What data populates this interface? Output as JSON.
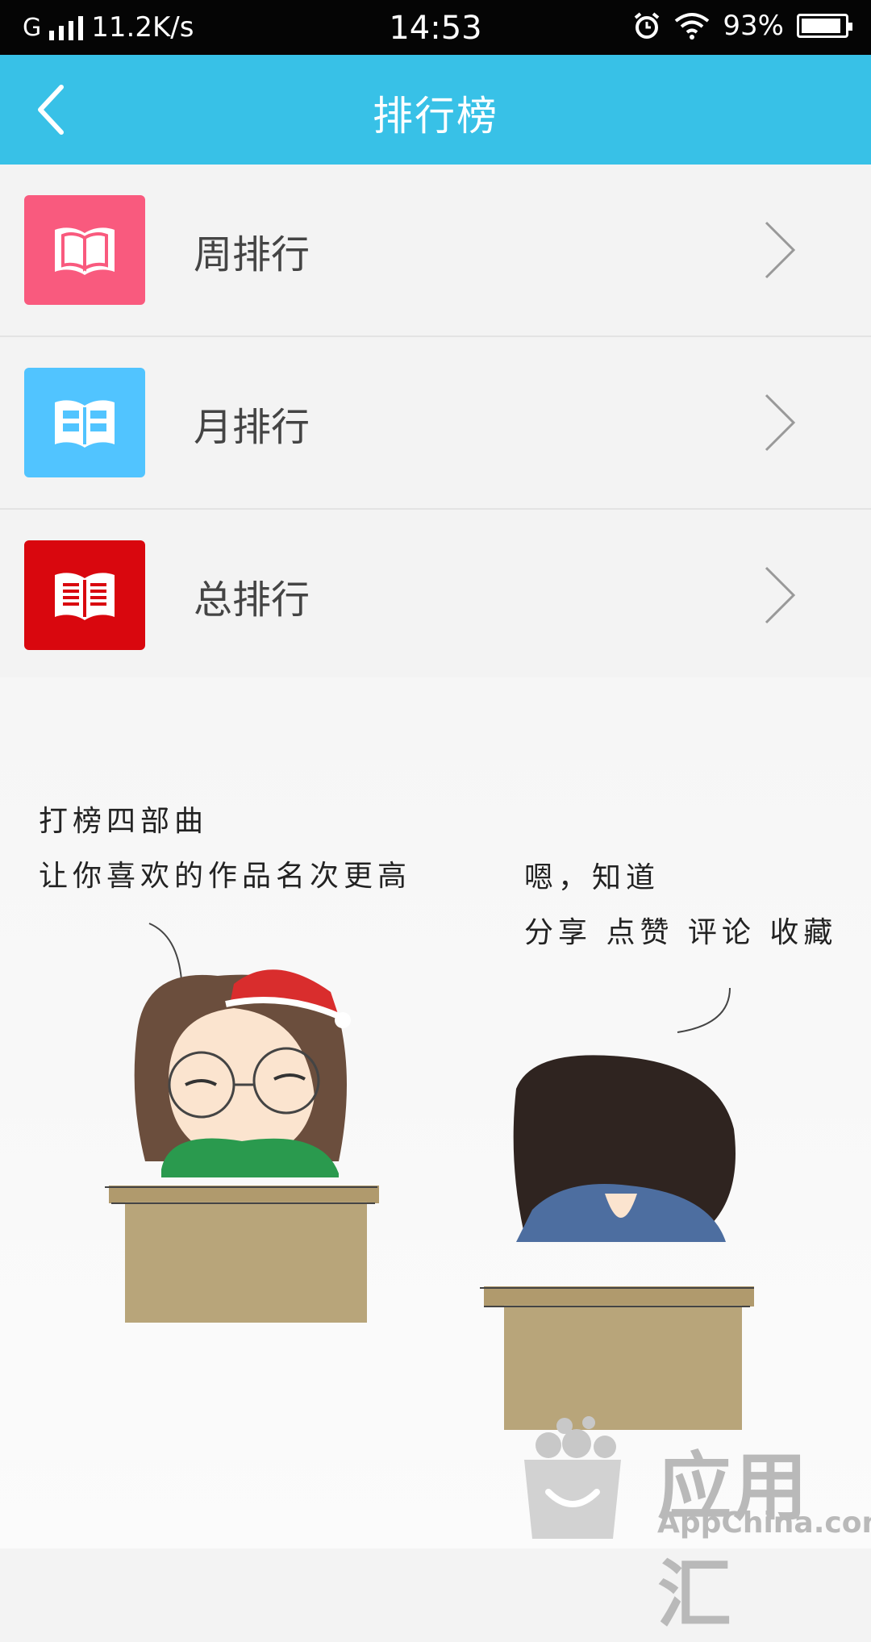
{
  "status_bar": {
    "network_type": "G",
    "speed": "11.2K/s",
    "time": "14:53",
    "battery_percent": "93%",
    "battery_level": 0.93,
    "icons": [
      "signal-icon",
      "alarm-icon",
      "wifi-icon",
      "battery-icon"
    ]
  },
  "header": {
    "title": "排行榜",
    "background_color": "#38c1e7"
  },
  "rankings": [
    {
      "label": "周排行",
      "icon": "open-book-icon",
      "color": "#f95a7e"
    },
    {
      "label": "月排行",
      "icon": "open-book-icon",
      "color": "#51c4ff"
    },
    {
      "label": "总排行",
      "icon": "open-book-icon",
      "color": "#d9070e"
    }
  ],
  "illustration": {
    "left_caption_line1": "打榜四部曲",
    "left_caption_line2": "让你喜欢的作品名次更高",
    "right_caption_line1": "嗯，知道",
    "right_caption_line2": "分享 点赞 评论 收藏"
  },
  "watermark": {
    "name": "应用汇",
    "domain": "AppChina.com"
  }
}
